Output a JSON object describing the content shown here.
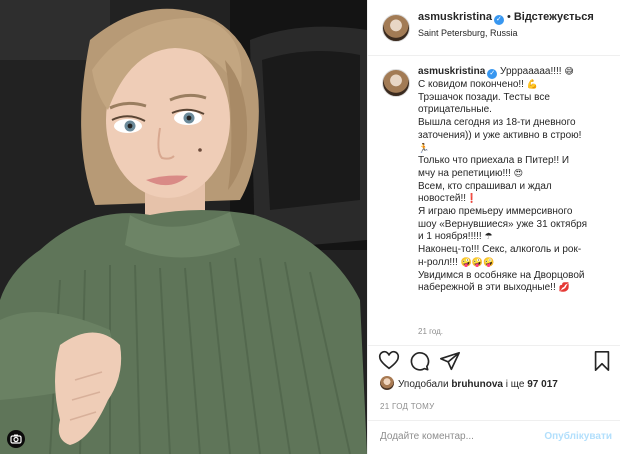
{
  "post": {
    "username": "asmuskristina",
    "verified_glyph": "✓",
    "dot": "•",
    "follow_label": "Відстежується",
    "location": "Saint Petersburg, Russia"
  },
  "caption": {
    "lines": [
      "Урррааааа!!!!",
      "С ковидом покончено!!",
      "Трэшачок позади. Тесты все",
      "отрицательные.",
      "Вышла сегодня из 18-ти дневного",
      "заточения)) и уже активно в строю!",
      "",
      "Только что приехала в Питер!! И",
      "мчу на репетицию!!!",
      "Всем, кто спрашивал и ждал",
      "новостей!!",
      "Я играю премьеру иммерсивного",
      "шоу «Вернувшиеся» уже 31 октября",
      "и 1 ноября!!!!!",
      "Наконец-то!!! Секс, алкоголь и рок-",
      "н-ролл!!!",
      "Увидимся в особняке на Дворцовой",
      "набережной в эти выходные!!"
    ],
    "time_ago": "21 год."
  },
  "likes": {
    "prefix": "Уподобали ",
    "liker": "bruhunova",
    "middle": " і ще ",
    "count": "97 017"
  },
  "posted_ago": "21 ГОД ТОМУ",
  "comment": {
    "placeholder": "Додайте коментар...",
    "publish_label": "Опублікувати"
  },
  "colors": {
    "link_blue": "#3897f0",
    "publish_disabled": "#b2dffc",
    "muted": "#8e8e8e",
    "sweater": "#5f7559"
  },
  "icons": {
    "like": "heart-icon",
    "comment": "comment-icon",
    "share": "share-icon",
    "save": "bookmark-icon",
    "camera_badge": "camera-icon"
  }
}
